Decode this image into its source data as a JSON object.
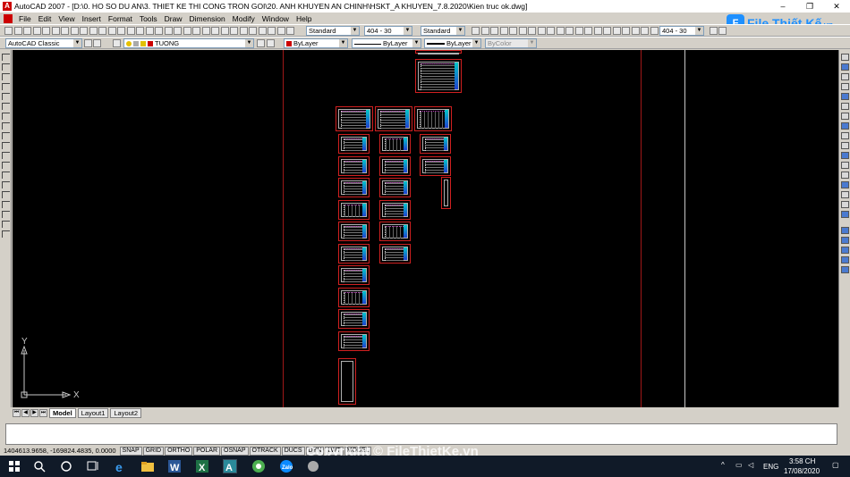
{
  "window": {
    "title": "AutoCAD 2007 - [D:\\0. HO SO DU AN\\3. THIET KE THI CONG TRON GOI\\20. ANH KHUYEN AN CHINH\\HSKT_A KHUYEN_7.8.2020\\Kien truc ok.dwg]",
    "app_icon": "autocad-icon",
    "controls": [
      "–",
      "❐",
      "✕"
    ]
  },
  "menu": [
    "File",
    "Edit",
    "View",
    "Insert",
    "Format",
    "Tools",
    "Draw",
    "Dimension",
    "Modify",
    "Window",
    "Help"
  ],
  "toolbar_styles": {
    "text_style": "Standard",
    "dim_style": "404 - 30",
    "table_style": "Standard",
    "multileader_style": "404 - 30"
  },
  "toolbar_layers": {
    "workspace": "AutoCAD Classic",
    "layer": "TUONG",
    "color": "ByLayer",
    "linetype": "ByLayer",
    "lineweight": "ByLayer",
    "plotstyle": "ByColor"
  },
  "logo": {
    "brand": "File Thiết Kế",
    "suffix": ".vn"
  },
  "canvas": {
    "ucs_x": "X",
    "ucs_y": "Y"
  },
  "tabs": [
    "Model",
    "Layout1",
    "Layout2"
  ],
  "active_tab": "Model",
  "status": {
    "coords": "1404613.9658, -169824.4835, 0.0000",
    "buttons": [
      "SNAP",
      "GRID",
      "ORTHO",
      "POLAR",
      "OSNAP",
      "OTRACK",
      "DUCS",
      "DYN",
      "LWT",
      "MODEL"
    ]
  },
  "watermark": "Copyright © FileThietKe.vn",
  "taskbar": {
    "language": "ENG",
    "time": "3:58 CH",
    "date": "17/08/2020"
  },
  "colors": {
    "canvas_bg": "#000000",
    "sheet_border": "#d02020",
    "chrome": "#d4d0c8",
    "taskbar": "#101a28"
  }
}
